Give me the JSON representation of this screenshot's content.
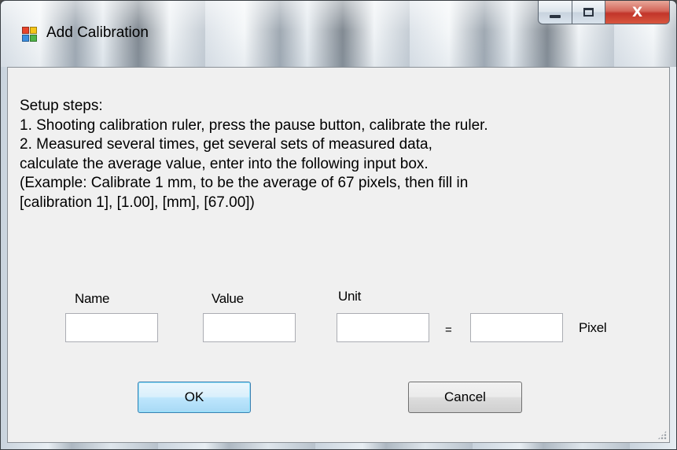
{
  "window": {
    "title": "Add Calibration",
    "close_glyph": "X"
  },
  "instructions": {
    "lines": [
      "Setup steps:",
      "1. Shooting calibration ruler, press the pause button, calibrate the ruler.",
      "2. Measured several times, get several sets of measured data,",
      "calculate the average value, enter into the following input box.",
      "(Example: Calibrate 1 mm, to be the average of 67 pixels, then fill in",
      "[calibration 1], [1.00], [mm], [67.00])"
    ]
  },
  "fields": {
    "name_label": "Name",
    "value_label": "Value",
    "unit_label": "Unit",
    "equals": "=",
    "pixel_label": "Pixel",
    "name_value": "",
    "value_value": "",
    "unit_value": "",
    "pixel_value": ""
  },
  "buttons": {
    "ok_label": "OK",
    "cancel_label": "Cancel"
  },
  "icons": {
    "app": "app-window-icon",
    "minimize": "minimize-icon",
    "maximize": "maximize-icon",
    "close": "close-icon",
    "grip": "resize-grip-icon"
  },
  "colors": {
    "dialog_background": "#f0f0f0",
    "close_button": "#c2352a",
    "ok_border": "#3c7fb1"
  }
}
